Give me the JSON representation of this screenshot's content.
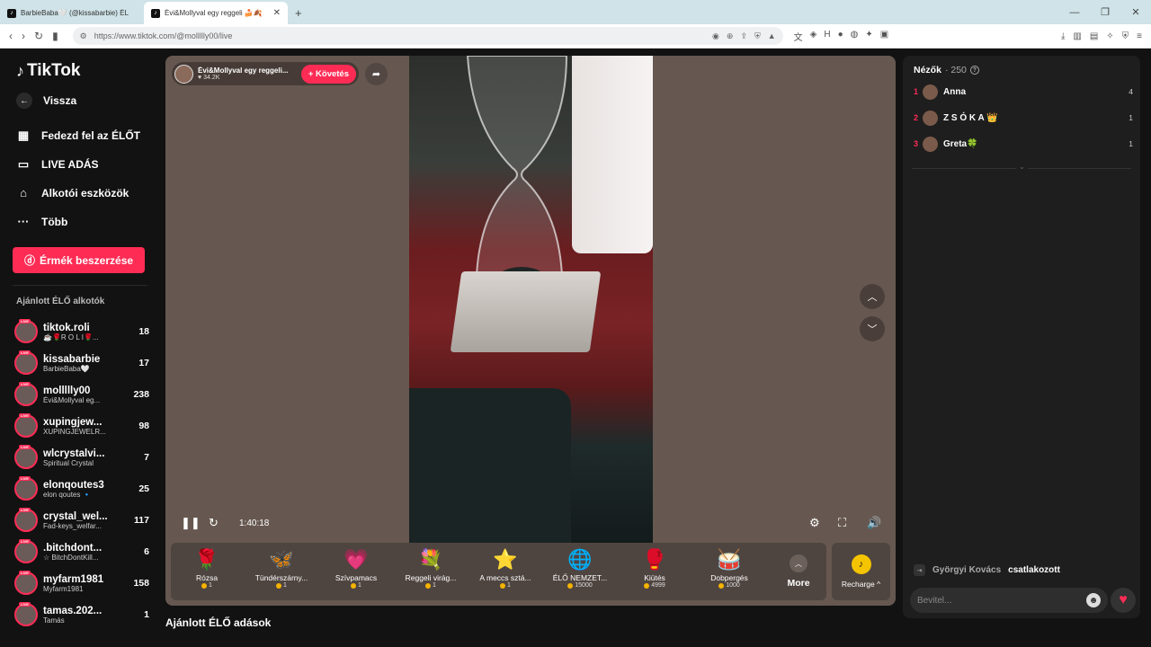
{
  "browser": {
    "tabs": [
      {
        "title": "BarbieBaba🤍 (@kissabarbie) ÉL",
        "active": false
      },
      {
        "title": "Évi&Mollyval egy reggeli 🍰🍂",
        "active": true
      }
    ],
    "url": "https://www.tiktok.com/@mollllly00/live"
  },
  "sidebar": {
    "logo": "TikTok",
    "back": "Vissza",
    "nav": [
      {
        "label": "Fedezd fel az ÉLŐT",
        "icon": "calendar-icon"
      },
      {
        "label": "LIVE ADÁS",
        "icon": "camera-icon"
      },
      {
        "label": "Alkotói eszközök",
        "icon": "home-icon"
      },
      {
        "label": "Több",
        "icon": "more-icon"
      }
    ],
    "coins_button": "Érmék beszerzése",
    "section_title": "Ajánlott ÉLŐ alkotók",
    "live_badge": "LIVE",
    "creators": [
      {
        "name": "tiktok.roli",
        "sub": "☕🌹R O L I🌹...",
        "count": "18"
      },
      {
        "name": "kissabarbie",
        "sub": "BarbieBaba🤍",
        "count": "17"
      },
      {
        "name": "mollllly00",
        "sub": "Évi&Mollyval eg...",
        "count": "238"
      },
      {
        "name": "xupingjew...",
        "sub": "XUPINGJEWELR...",
        "count": "98"
      },
      {
        "name": "wlcrystalvi...",
        "sub": "Spiritual Crystal",
        "count": "7"
      },
      {
        "name": "elonqoutes3",
        "sub": "elon qoutes 🔹",
        "count": "25"
      },
      {
        "name": "crystal_wel...",
        "sub": "Fad-keys_welfar...",
        "count": "117"
      },
      {
        "name": ".bitchdont...",
        "sub": "☆ BitchDontKill...",
        "count": "6"
      },
      {
        "name": "myfarm1981",
        "sub": "Myfarm1981",
        "count": "158"
      },
      {
        "name": "tamas.202...",
        "sub": "Tamás",
        "count": "1"
      }
    ]
  },
  "stream": {
    "host_title": "Évi&Mollyval egy reggeli...",
    "likes": "34.2K",
    "follow": "+ Követés",
    "time": "1:40:18"
  },
  "gifts": [
    {
      "name": "Rózsa",
      "price": "1",
      "icon": "🌹"
    },
    {
      "name": "Tündérszárny...",
      "price": "1",
      "icon": "🦋"
    },
    {
      "name": "Szívpamacs",
      "price": "1",
      "icon": "💗"
    },
    {
      "name": "Reggeli virág...",
      "price": "1",
      "icon": "💐"
    },
    {
      "name": "A meccs sztá...",
      "price": "1",
      "icon": "⭐"
    },
    {
      "name": "ÉLŐ NEMZET...",
      "price": "15000",
      "icon": "🌐"
    },
    {
      "name": "Kiütés",
      "price": "4999",
      "icon": "🥊"
    },
    {
      "name": "Dobpergés",
      "price": "1000",
      "icon": "🥁"
    }
  ],
  "more_label": "More",
  "recharge_label": "Recharge ^",
  "recommended_title": "Ajánlott ÉLŐ adások",
  "chat": {
    "viewers_label": "Nézők",
    "viewers_count": "· 250",
    "viewers": [
      {
        "rank": "1",
        "name": "Anna",
        "score": "4"
      },
      {
        "rank": "2",
        "name": "Z S Ó K A 👑",
        "score": "1"
      },
      {
        "rank": "3",
        "name": "Greta🍀",
        "score": "1"
      }
    ],
    "joined_name": "Györgyi Kovács",
    "joined_text": "csatlakozott",
    "input_placeholder": "Bevitel..."
  }
}
